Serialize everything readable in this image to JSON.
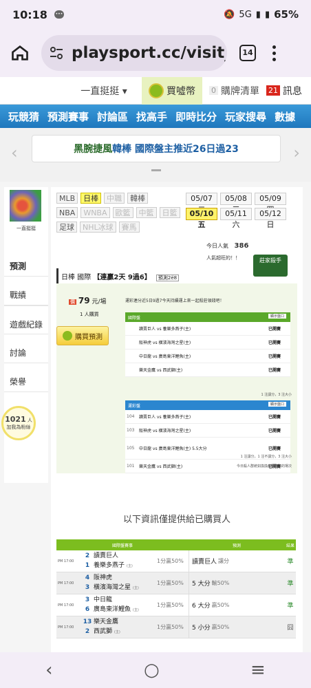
{
  "status": {
    "time": "10:18",
    "network": "5G",
    "battery": "65%"
  },
  "browser": {
    "url": "playsport.cc/visit_",
    "tab_count": "14"
  },
  "topbar": {
    "user_menu": "一直挺挺 ▾",
    "coin": "買噓幣",
    "cart_count": "0",
    "cart": "購牌清單",
    "msg_count": "21",
    "msg": "訊息"
  },
  "nav": [
    "玩競猜",
    "預測賽事",
    "討論區",
    "找高手",
    "即時比分",
    "玩家搜尋",
    "數據"
  ],
  "banner": {
    "prefix": "黑腕捷風 ",
    "highlight": "韓棒 國際盤主推近26日過23"
  },
  "profile": {
    "name": "一直挺挺"
  },
  "side": {
    "items": [
      "預測",
      "戰績",
      "遊戲紀錄",
      "討論",
      "榮譽"
    ],
    "fans_count": "1021",
    "fans_label": "人",
    "fans_note": "加我為粉絲"
  },
  "leagues": {
    "row1": [
      "MLB",
      "日棒",
      "中職",
      "韓棒"
    ],
    "row2": [
      "NBA",
      "WNBA",
      "歐籃",
      "中籃",
      "日籃"
    ],
    "row3": [
      "足球",
      "NHL冰球",
      "賽馬"
    ]
  },
  "dates": [
    "05/07 二",
    "05/08 三",
    "05/09 四",
    "05/10 五",
    "05/11 六",
    "05/12 日"
  ],
  "visits": {
    "label": "今日人氣",
    "value": "386"
  },
  "flag": "人氣超旺的！！",
  "king": "莊家殺手",
  "pred": {
    "league": "日棒 國際",
    "streak": "【連贏2天 9過6】",
    "tag": "預測2ё8"
  },
  "price": {
    "badge": "價",
    "value": "79",
    "unit": "元/場"
  },
  "buyers": "1 人購買",
  "buy_button": "購買預測",
  "intro": "運彩連分近5日9過7今天持續運上來一起殺莊領錢吧！",
  "table_intl": {
    "title": "國際盤",
    "small": "顯示盤口",
    "rows": [
      {
        "num": "",
        "teams": "讀賣巨人 vs 養樂多燕子(主)",
        "status": "已開賽"
      },
      {
        "num": "",
        "teams": "阪神虎 vs 橫濱海灣之星(主)",
        "status": "已開賽"
      },
      {
        "num": "",
        "teams": "中日龍 vs 廣島東洋鯉魚(主)",
        "status": "已開賽"
      },
      {
        "num": "",
        "teams": "樂天金鷹 vs 西武獅(主)",
        "status": "已開賽"
      }
    ],
    "foot": "1 注讓分，3 注大小"
  },
  "table_lottery": {
    "title": "運彩盤",
    "small": "顯示盤口",
    "rows": [
      {
        "num": "104",
        "teams": "讀賣巨人 vs 養樂多燕子(主)",
        "status": "已開賽"
      },
      {
        "num": "103",
        "teams": "阪神虎 vs 橫濱海灣之星(主)",
        "status": "已開賽"
      },
      {
        "num": "105",
        "teams": "中日龍 vs 廣島東洋鯉魚(主)  5.5大分",
        "status": "已開賽"
      },
      {
        "num": "101",
        "teams": "樂天金鷹 vs 西武獅(主)",
        "status": "已開賽"
      }
    ],
    "foot": "1 注讓分，1 注不讓分，3 注大小",
    "note": "今日殺人群統如換換瘦數查您的場次"
  },
  "buyinfo": "以下資訊僅提供給已購買人",
  "big": {
    "headers": [
      "國際盤賽事",
      "預測",
      "結果"
    ],
    "rows": [
      {
        "time": "PM 17:00",
        "n1": "2",
        "t1": "讀賣巨人",
        "n2": "1",
        "t2": "養樂多燕子",
        "spread": "1分贏50%",
        "pick": "讀賣巨人",
        "pick_note": "讓分",
        "result": "準"
      },
      {
        "time": "PM 17:00",
        "n1": "4",
        "t1": "阪神虎",
        "n2": "3",
        "t2": "橫濱海灣之星",
        "spread": "1分贏50%",
        "pick": "5 大分",
        "pick_note": "輸50%",
        "result": "準"
      },
      {
        "time": "PM 17:00",
        "n1": "3",
        "t1": "中日龍",
        "n2": "6",
        "t2": "廣島東洋鯉魚",
        "spread": "1分贏50%",
        "pick": "6 大分",
        "pick_note": "贏50%",
        "result": "準"
      },
      {
        "time": "PM 17:00",
        "n1": "13",
        "t1": "樂天金鷹",
        "n2": "2",
        "t2": "西武獅",
        "spread": "1分贏50%",
        "pick": "5 小分",
        "pick_note": "贏50%",
        "result": "囧"
      }
    ]
  }
}
